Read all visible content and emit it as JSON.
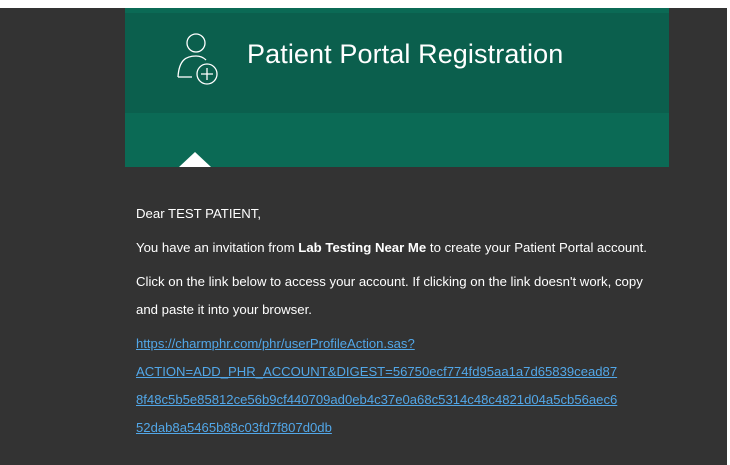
{
  "colors": {
    "frame_background": "#333333",
    "banner_background": "#0b6a55",
    "banner_top": "#0b5f4d",
    "text": "#ffffff",
    "link": "#52a7e8"
  },
  "banner": {
    "icon": "add-user-icon",
    "title": "Patient Portal Registration"
  },
  "email": {
    "greeting": "Dear TEST PATIENT,",
    "invitation_prefix": "You have an invitation from ",
    "organization": "Lab Testing Near Me",
    "invitation_suffix": " to create your Patient Portal account.",
    "instructions": "Click on the link below to access your account. If clicking on the link doesn't work, copy and paste it into your browser.",
    "link_lines": [
      "https://charmphr.com/phr/userProfileAction.sas?",
      "ACTION=ADD_PHR_ACCOUNT&DIGEST=56750ecf774fd95aa1a7d65839cead87",
      "8f48c5b5e85812ce56b9cf440709ad0eb4c37e0a68c5314c48c4821d04a5cb56aec6",
      "52dab8a5465b88c03fd7f807d0db"
    ]
  }
}
